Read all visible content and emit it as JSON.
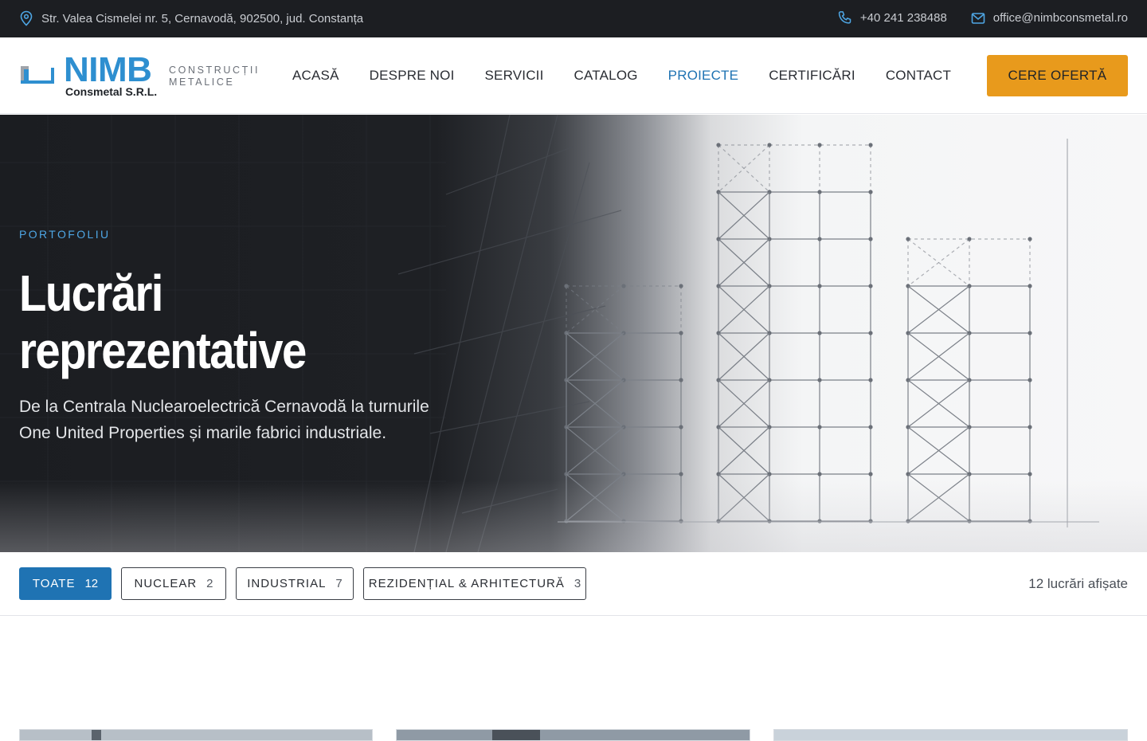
{
  "topbar": {
    "address": "Str. Valea Cismelei nr. 5, Cernavodă, 902500, jud. Constanța",
    "phone": "+40 241 238488",
    "email": "office@nimbconsmetal.ro"
  },
  "logo": {
    "name": "NIMB",
    "company": "Consmetal S.R.L.",
    "tagline_line1": "CONSTRUCȚII",
    "tagline_line2": "METALICE"
  },
  "nav": {
    "items": [
      {
        "label": "ACASĂ",
        "active": false
      },
      {
        "label": "DESPRE NOI",
        "active": false
      },
      {
        "label": "SERVICII",
        "active": false
      },
      {
        "label": "CATALOG",
        "active": false
      },
      {
        "label": "PROIECTE",
        "active": true
      },
      {
        "label": "CERTIFICĂRI",
        "active": false
      },
      {
        "label": "CONTACT",
        "active": false
      }
    ],
    "cta_label": "CERE OFERTĂ"
  },
  "hero": {
    "eyebrow": "PORTOFOLIU",
    "title_line1": "Lucrări",
    "title_line2": "reprezentative",
    "subtitle_line1": "De la Centrala Nuclearoelectrică Cernavodă la turnurile",
    "subtitle_line2": "One United Properties și marile fabrici industriale."
  },
  "filters": {
    "items": [
      {
        "label": "TOATE",
        "count": "12",
        "active": true
      },
      {
        "label": "NUCLEAR",
        "count": "2",
        "active": false
      },
      {
        "label": "INDUSTRIAL",
        "count": "7",
        "active": false
      },
      {
        "label": "REZIDENȚIAL & ARHITECTURĂ",
        "count": "3",
        "active": false
      }
    ],
    "shown_text": "12 lucrări afișate"
  },
  "icons": {
    "address": "location-pin-icon",
    "phone": "phone-icon",
    "email": "mail-icon"
  },
  "colors": {
    "brand_blue": "#2e8fd0",
    "accent_blue": "#1f73b3",
    "cta_orange": "#e89a1c",
    "topbar_bg": "#1c1e22"
  }
}
